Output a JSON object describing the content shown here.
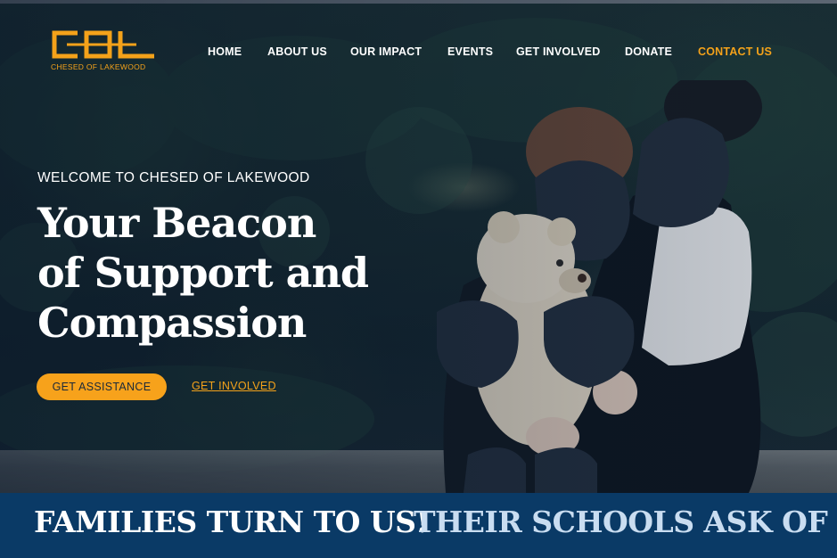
{
  "brand": {
    "logo_letters": "CDL",
    "logo_tagline": "CHESED OF LAKEWOOD",
    "accent": "#f4a21a"
  },
  "nav": {
    "items": [
      {
        "label": "HOME"
      },
      {
        "label": "ABOUT US"
      },
      {
        "label": "OUR IMPACT"
      },
      {
        "label": "EVENTS"
      },
      {
        "label": "GET INVOLVED"
      },
      {
        "label": "DONATE"
      },
      {
        "label": "CONTACT US",
        "active": true
      }
    ]
  },
  "hero": {
    "welcome": "WELCOME TO CHESED OF LAKEWOOD",
    "headline_lines": [
      "Your Beacon",
      "of Support and",
      "Compassion"
    ],
    "primary_button": "GET ASSISTANCE",
    "secondary_link": "GET INVOLVED",
    "image_alt": "child-hugging-teddy-bear-photo"
  },
  "ticker": {
    "items": [
      "FAMILIES TURN TO US!",
      "THEIR SCHOOLS ASK OF US"
    ]
  },
  "colors": {
    "button": "#f7a21b",
    "band": "#0a3a66",
    "ticker_secondary": "#c9ddf1"
  }
}
